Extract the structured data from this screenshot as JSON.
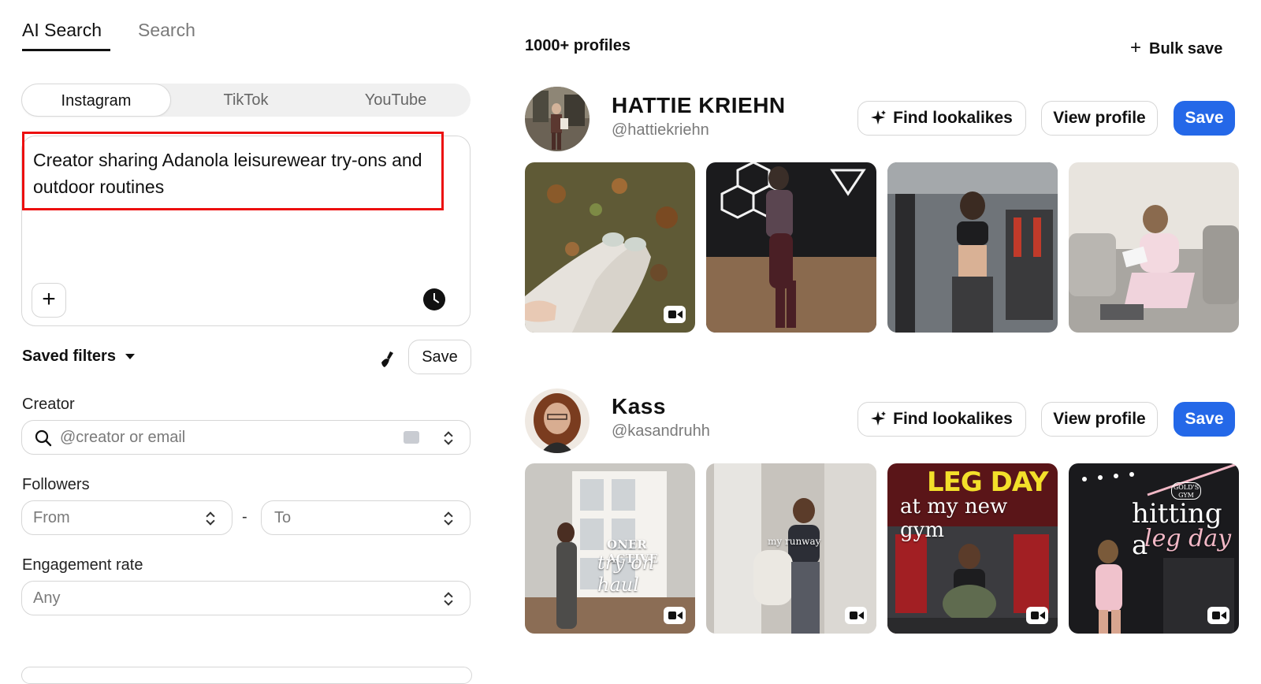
{
  "tabs": [
    {
      "label": "AI Search",
      "active": true
    },
    {
      "label": "Search",
      "active": false
    }
  ],
  "platforms": [
    {
      "label": "Instagram",
      "active": true
    },
    {
      "label": "TikTok",
      "active": false
    },
    {
      "label": "YouTube",
      "active": false
    }
  ],
  "query": {
    "text": "Creator sharing Adanola leisurewear try-ons and outdoor routines",
    "add_icon": "plus-icon",
    "history_icon": "clock-icon",
    "highlight_color": "#ec0f0f"
  },
  "saved_filters": {
    "label": "Saved filters",
    "clear_icon": "broom-icon",
    "save_label": "Save"
  },
  "filters": {
    "creator": {
      "label": "Creator",
      "placeholder": "@creator or email"
    },
    "followers": {
      "label": "Followers",
      "from_placeholder": "From",
      "separator": "-",
      "to_placeholder": "To"
    },
    "engagement": {
      "label": "Engagement rate",
      "value": "Any"
    }
  },
  "results": {
    "count": "1000+ profiles",
    "bulk_save": "Bulk save",
    "accent_color": "#2468e8",
    "profiles": [
      {
        "name": "HATTIE KRIEHN",
        "handle": "@hattiekriehn",
        "find_lookalikes": "Find lookalikes",
        "view_profile": "View profile",
        "save": "Save",
        "posts": [
          {
            "kind": "photo-leaves",
            "video": true
          },
          {
            "kind": "gym-mirror-hex-lights",
            "video": false
          },
          {
            "kind": "gym-mirror-selfie",
            "video": false
          },
          {
            "kind": "sofa-pink-outfit",
            "video": false
          }
        ]
      },
      {
        "name": "Kass",
        "handle": "@kasandruhh",
        "find_lookalikes": "Find lookalikes",
        "view_profile": "View profile",
        "save": "Save",
        "posts": [
          {
            "kind": "try-on-haul",
            "video": true,
            "overlay_line1": "ONER ACTIVE",
            "overlay_line2": "try on haul"
          },
          {
            "kind": "runway-locker",
            "video": true,
            "overlay_line1": "my runway"
          },
          {
            "kind": "leg-day",
            "video": true,
            "overlay_line1": "LEG DAY",
            "overlay_line2": "at my new gym"
          },
          {
            "kind": "hitting-leg-day",
            "video": true,
            "overlay_line1": "hitting a",
            "overlay_line2": "leg day",
            "badge": "GOLD'S GYM"
          }
        ]
      }
    ]
  }
}
